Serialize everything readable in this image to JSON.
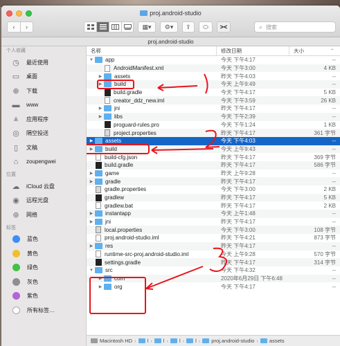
{
  "window": {
    "title": "proj.android-studio"
  },
  "toolbar": {
    "back_icon": "chevron-left-icon",
    "forward_icon": "chevron-right-icon",
    "search_placeholder": "搜索"
  },
  "pathbar_title": "proj.android-studio",
  "sidebar": {
    "favorites_label": "个人收藏",
    "favorites": [
      {
        "label": "最近使用",
        "icon": "clock-icon"
      },
      {
        "label": "桌面",
        "icon": "desktop-icon"
      },
      {
        "label": "下载",
        "icon": "download-icon"
      },
      {
        "label": "www",
        "icon": "folder-icon"
      },
      {
        "label": "应用程序",
        "icon": "applications-icon"
      },
      {
        "label": "隔空投送",
        "icon": "airdrop-icon"
      },
      {
        "label": "文稿",
        "icon": "document-icon"
      },
      {
        "label": "zoupengwei",
        "icon": "home-icon"
      }
    ],
    "locations_label": "位置",
    "locations": [
      {
        "label": "iCloud 云盘",
        "icon": "cloud-icon"
      },
      {
        "label": "远程光盘",
        "icon": "disc-icon"
      },
      {
        "label": "网络",
        "icon": "network-icon"
      }
    ],
    "tags_label": "标签",
    "tags": [
      {
        "label": "蓝色",
        "color": "#3e8df7"
      },
      {
        "label": "黄色",
        "color": "#f2bf2c"
      },
      {
        "label": "绿色",
        "color": "#43c046"
      },
      {
        "label": "灰色",
        "color": "#8e8e93"
      },
      {
        "label": "紫色",
        "color": "#b463d8"
      },
      {
        "label": "所有标签…",
        "color": "#c9c9c9"
      }
    ]
  },
  "columns": {
    "name": "名称",
    "date": "修改日期",
    "size": "大小"
  },
  "files": [
    {
      "name": "app",
      "date": "今天 下午4:17",
      "size": "--",
      "type": "folder",
      "depth": 0,
      "disclosure": "open"
    },
    {
      "name": "AndroidManifest.xml",
      "date": "今天 下午3:00",
      "size": "4 KB",
      "type": "file",
      "depth": 1,
      "disclosure": "none"
    },
    {
      "name": "assets",
      "date": "昨天 下午4:03",
      "size": "--",
      "type": "folder",
      "depth": 1,
      "disclosure": "closed"
    },
    {
      "name": "build",
      "date": "今天 上午9:49",
      "size": "--",
      "type": "folder",
      "depth": 1,
      "disclosure": "closed"
    },
    {
      "name": "build.gradle",
      "date": "今天 下午4:17",
      "size": "5 KB",
      "type": "exec",
      "depth": 1,
      "disclosure": "none"
    },
    {
      "name": "creator_ddz_new.iml",
      "date": "今天 下午3:59",
      "size": "26 KB",
      "type": "file",
      "depth": 1,
      "disclosure": "none"
    },
    {
      "name": "jni",
      "date": "昨天 下午4:17",
      "size": "--",
      "type": "folder",
      "depth": 1,
      "disclosure": "closed"
    },
    {
      "name": "libs",
      "date": "今天 下午2:39",
      "size": "--",
      "type": "folder",
      "depth": 1,
      "disclosure": "closed"
    },
    {
      "name": "proguard-rules.pro",
      "date": "今天 下午1:24",
      "size": "1 KB",
      "type": "exec",
      "depth": 1,
      "disclosure": "none"
    },
    {
      "name": "project.properties",
      "date": "昨天 下午4:17",
      "size": "361 字节",
      "type": "gear",
      "depth": 1,
      "disclosure": "none"
    },
    {
      "name": "assets",
      "date": "今天 下午4:03",
      "size": "--",
      "type": "folder",
      "depth": 0,
      "disclosure": "closed",
      "selected": true
    },
    {
      "name": "build",
      "date": "今天 上午9:43",
      "size": "--",
      "type": "folder",
      "depth": 0,
      "disclosure": "closed"
    },
    {
      "name": "build-cfg.json",
      "date": "昨天 下午4:17",
      "size": "369 字节",
      "type": "file",
      "depth": 0,
      "disclosure": "none"
    },
    {
      "name": "build.gradle",
      "date": "昨天 下午4:17",
      "size": "586 字节",
      "type": "exec",
      "depth": 0,
      "disclosure": "none"
    },
    {
      "name": "game",
      "date": "昨天 上午9:28",
      "size": "--",
      "type": "folder",
      "depth": 0,
      "disclosure": "closed"
    },
    {
      "name": "gradle",
      "date": "昨天 下午4:17",
      "size": "--",
      "type": "folder",
      "depth": 0,
      "disclosure": "closed"
    },
    {
      "name": "gradle.properties",
      "date": "今天 下午3:00",
      "size": "2 KB",
      "type": "gear",
      "depth": 0,
      "disclosure": "none"
    },
    {
      "name": "gradlew",
      "date": "昨天 下午4:17",
      "size": "5 KB",
      "type": "exec",
      "depth": 0,
      "disclosure": "none"
    },
    {
      "name": "gradlew.bat",
      "date": "昨天 下午4:17",
      "size": "2 KB",
      "type": "file",
      "depth": 0,
      "disclosure": "none"
    },
    {
      "name": "instantapp",
      "date": "今天 上午1:48",
      "size": "--",
      "type": "folder",
      "depth": 0,
      "disclosure": "closed"
    },
    {
      "name": "jni",
      "date": "昨天 下午4:17",
      "size": "--",
      "type": "folder",
      "depth": 0,
      "disclosure": "closed"
    },
    {
      "name": "local.properties",
      "date": "今天 下午3:00",
      "size": "108 字节",
      "type": "gear",
      "depth": 0,
      "disclosure": "none"
    },
    {
      "name": "proj.android-studio.iml",
      "date": "昨天 下午4:21",
      "size": "873 字节",
      "type": "file",
      "depth": 0,
      "disclosure": "none"
    },
    {
      "name": "res",
      "date": "昨天 下午4:17",
      "size": "--",
      "type": "folder",
      "depth": 0,
      "disclosure": "closed"
    },
    {
      "name": "runtime-src-proj.android-studio.iml",
      "date": "今天 上午9:28",
      "size": "570 字节",
      "type": "file",
      "depth": 0,
      "disclosure": "none"
    },
    {
      "name": "settings.gradle",
      "date": "昨天 下午4:17",
      "size": "314 字节",
      "type": "exec",
      "depth": 0,
      "disclosure": "none"
    },
    {
      "name": "src",
      "date": "今天 下午4:32",
      "size": "--",
      "type": "folder",
      "depth": 0,
      "disclosure": "open"
    },
    {
      "name": "com",
      "date": "2020年6月29日 下午6:48",
      "size": "--",
      "type": "folder",
      "depth": 1,
      "disclosure": "closed"
    },
    {
      "name": "org",
      "date": "今天 下午4:17",
      "size": "--",
      "type": "folder",
      "depth": 1,
      "disclosure": "closed"
    }
  ],
  "annotations": [
    "1",
    "2",
    "3"
  ],
  "statusbar": {
    "crumbs": [
      "Macintosh HD",
      "›",
      "l",
      "›",
      "l",
      "›",
      "l",
      "›",
      "l",
      "›",
      "proj.android-studio",
      "›",
      "assets"
    ]
  },
  "colors": {
    "selection": "#1565c7",
    "folder": "#5fb0ef",
    "annotation": "#e8141a"
  }
}
